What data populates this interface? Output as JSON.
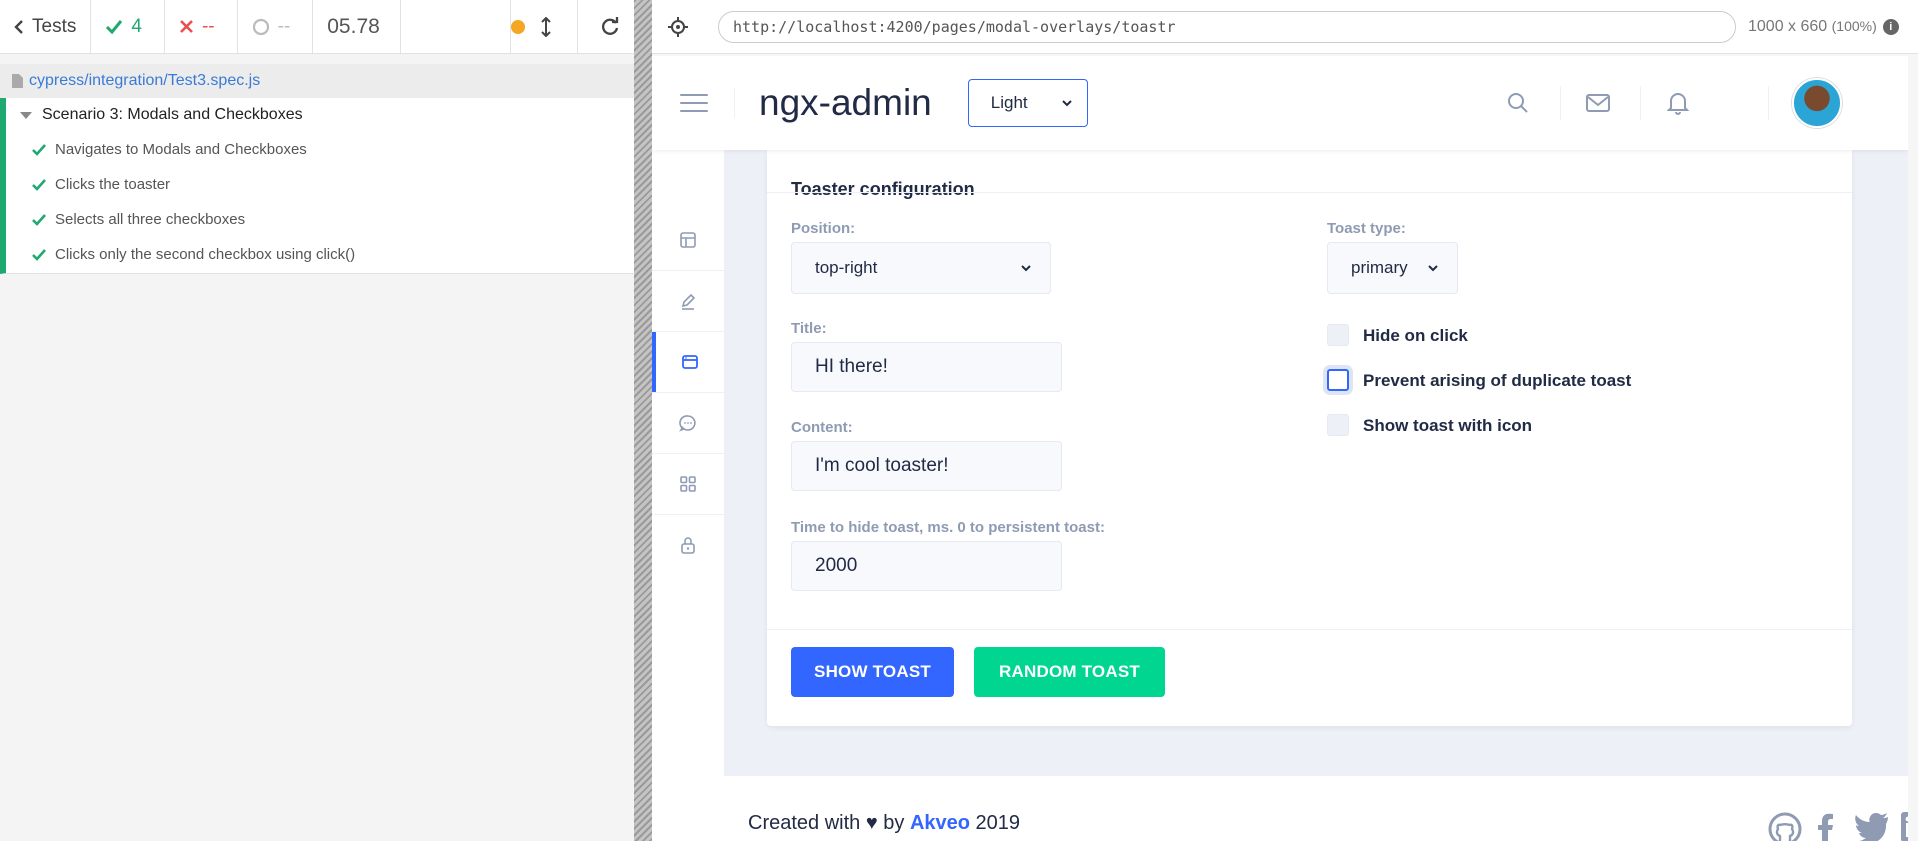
{
  "runner": {
    "back_label": "Tests",
    "passed_count": "4",
    "failed_count": "--",
    "pending_count": "--",
    "duration": "05.78",
    "spec_path": "cypress/integration/Test3.spec.js",
    "suite_title": "Scenario 3: Modals and Checkboxes",
    "tests": [
      "Navigates to Modals and Checkboxes",
      "Clicks the toaster",
      "Selects all three checkboxes",
      "Clicks only the second checkbox using click()"
    ]
  },
  "browser": {
    "url": "http://localhost:4200/pages/modal-overlays/toastr",
    "viewport": "1000 x 660",
    "zoom": "(100%)"
  },
  "app": {
    "brand": "ngx-admin",
    "theme": "Light"
  },
  "card": {
    "title": "Toaster configuration",
    "position_label": "Position:",
    "position_value": "top-right",
    "toast_type_label": "Toast type:",
    "toast_type_value": "primary",
    "title_label": "Title:",
    "title_value": "HI there!",
    "content_label": "Content:",
    "content_value": "I'm cool toaster!",
    "time_label": "Time to hide toast, ms. 0 to persistent toast:",
    "time_value": "2000",
    "checkboxes": [
      {
        "label": "Hide on click",
        "checked": false
      },
      {
        "label": "Prevent arising of duplicate toast",
        "checked": false
      },
      {
        "label": "Show toast with icon",
        "checked": false
      }
    ],
    "show_button": "SHOW TOAST",
    "random_button": "RANDOM TOAST"
  },
  "footer": {
    "prefix": "Created with ♥ by",
    "brand": "Akveo",
    "year": "2019"
  },
  "colors": {
    "primary": "#3366ff",
    "success": "#00d68f",
    "cypress_pass": "#1fa971"
  }
}
